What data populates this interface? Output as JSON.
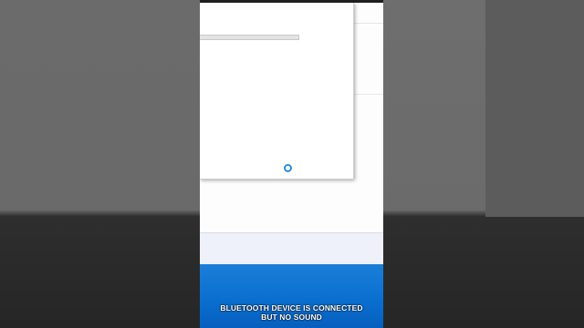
{
  "caption": {
    "line1": "BLUETOOTH DEVICE IS CONNECTED",
    "line2": "BUT NO SOUND"
  },
  "dialog": {
    "progress_fraction": 0,
    "busy_indicator": "loading-ring-icon"
  },
  "colors": {
    "accent": "#0078d7",
    "spinner": "#2a8fe0",
    "desktop_blue": "#0a6fd0",
    "strip_bg": "#eef0fa"
  }
}
